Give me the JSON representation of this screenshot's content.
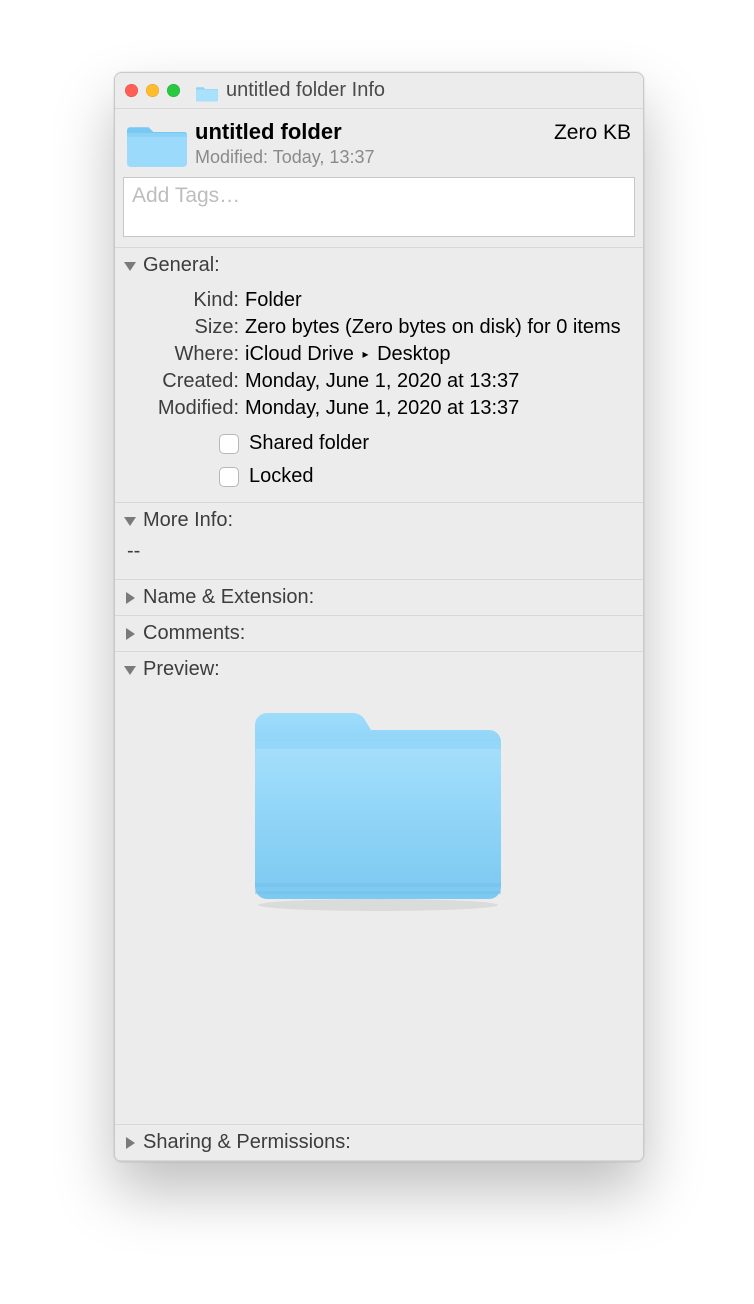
{
  "window": {
    "title": "untitled folder Info"
  },
  "header": {
    "name": "untitled folder",
    "modified_label": "Modified:",
    "modified_value": "Today, 13:37",
    "size": "Zero KB"
  },
  "tags": {
    "placeholder": "Add Tags…"
  },
  "sections": {
    "general": {
      "title": "General:",
      "kind_label": "Kind:",
      "kind_value": "Folder",
      "size_label": "Size:",
      "size_value": "Zero bytes (Zero bytes on disk) for 0 items",
      "where_label": "Where:",
      "where_value_1": "iCloud Drive",
      "where_value_2": "Desktop",
      "created_label": "Created:",
      "created_value": "Monday, June 1, 2020 at 13:37",
      "modified_label": "Modified:",
      "modified_value": "Monday, June 1, 2020 at 13:37",
      "shared_label": "Shared folder",
      "locked_label": "Locked",
      "shared_checked": false,
      "locked_checked": false
    },
    "more_info": {
      "title": "More Info:",
      "value": "--"
    },
    "name_ext": {
      "title": "Name & Extension:"
    },
    "comments": {
      "title": "Comments:"
    },
    "preview": {
      "title": "Preview:"
    },
    "sharing": {
      "title": "Sharing & Permissions:"
    }
  }
}
